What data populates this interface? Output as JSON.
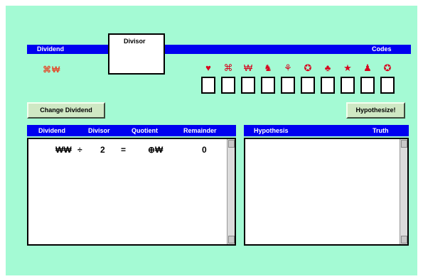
{
  "header": {
    "dividend_label": "Dividend",
    "divisor_label": "Divisor",
    "codes_label": "Codes"
  },
  "dividend_value": "⌘₩",
  "codes": [
    {
      "symbol": "♥",
      "color": "#d8001c"
    },
    {
      "symbol": "⌘",
      "color": "#d8001c"
    },
    {
      "symbol": "₩",
      "color": "#d8001c"
    },
    {
      "symbol": "♞",
      "color": "#d8001c"
    },
    {
      "symbol": "⚘",
      "color": "#d8001c"
    },
    {
      "symbol": "✪",
      "color": "#d8001c"
    },
    {
      "symbol": "♣",
      "color": "#d8001c"
    },
    {
      "symbol": "★",
      "color": "#d8001c"
    },
    {
      "symbol": "♟",
      "color": "#d8001c"
    },
    {
      "symbol": "✪",
      "color": "#d8001c"
    }
  ],
  "buttons": {
    "change_dividend": "Change Dividend",
    "hypothesize": "Hypothesize!"
  },
  "left_panel": {
    "headers": [
      "Dividend",
      "Divisor",
      "Quotient",
      "Remainder"
    ],
    "rows": [
      {
        "dividend": "₩₩",
        "op": "÷",
        "divisor": "2",
        "eq": "=",
        "quotient": "⊕₩",
        "remainder": "0"
      }
    ]
  },
  "right_panel": {
    "headers": [
      "Hypothesis",
      "Truth"
    ]
  },
  "colors": {
    "background": "#a4fad4",
    "bar": "#0000f0",
    "symbol": "#d8001c",
    "button": "#cfe8c4"
  }
}
